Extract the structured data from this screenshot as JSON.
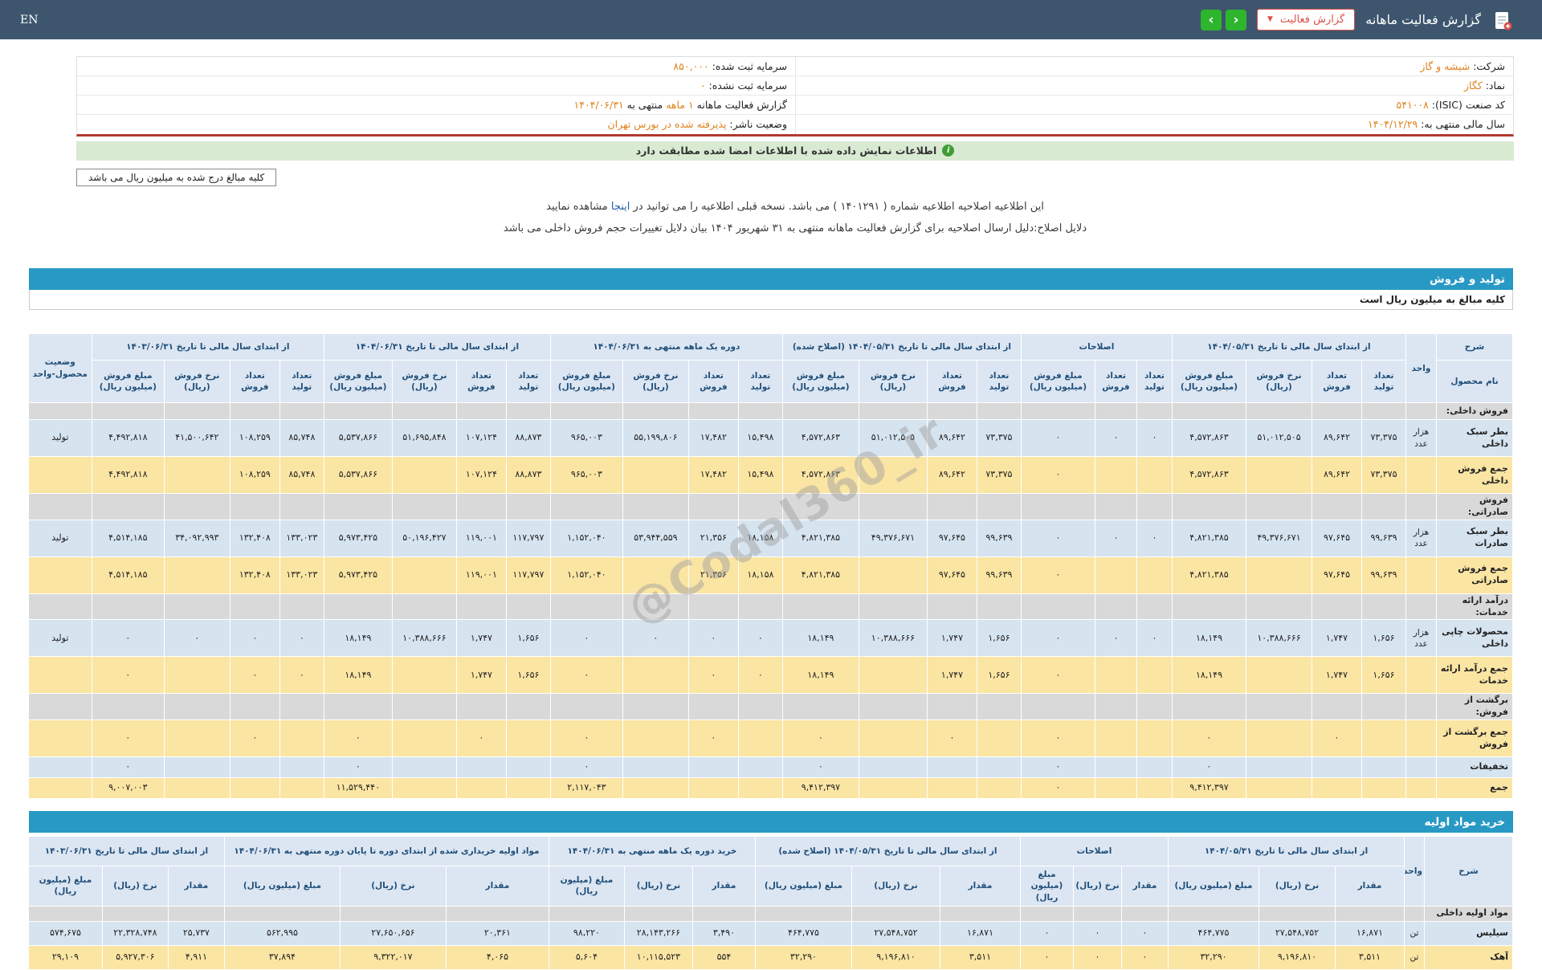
{
  "colors": {
    "topbar": "#3d566e",
    "nav_green": "#2db52d",
    "report_btn_red": "#d9534a",
    "value_orange": "#e0821e",
    "signed_bar_bg": "#d9ead3",
    "signed_icon_green": "#3f9c35",
    "section_bar_blue": "#2899c4",
    "table_header_bg": "#dce6f2",
    "table_header_text": "#1f4e79",
    "row_blue": "#d6e4f0",
    "row_yellow": "#fbe5a3",
    "row_gray": "#d9d9d9",
    "divider_red": "#b03a2e"
  },
  "icons": {
    "chevron_down": "▼",
    "nav_left": "‹",
    "nav_right": "›",
    "info": "i"
  },
  "watermark": "@Codal360_ir",
  "topbar": {
    "title": "گزارش فعالیت ماهانه",
    "report_button": "گزارش فعالیت",
    "lang": "EN"
  },
  "info": {
    "company_label": "شرکت:",
    "company": "شیشه و گاز",
    "symbol_label": "نماد:",
    "symbol": "کگاز",
    "isic_label": "کد صنعت (ISIC):",
    "isic": "۵۴۱۰۰۸",
    "fiscal_year_label": "سال مالی منتهی به:",
    "fiscal_year": "۱۴۰۴/۱۲/۲۹",
    "registered_capital_label": "سرمایه ثبت شده:",
    "registered_capital": "۸۵۰,۰۰۰",
    "unregistered_capital_label": "سرمایه ثبت نشده:",
    "unregistered_capital": "۰",
    "report_period_label": "گزارش فعالیت ماهانه",
    "report_period_value": "۱ ماهه",
    "report_period_mid": "منتهی به",
    "report_period_date": "۱۴۰۴/۰۶/۳۱",
    "publisher_status_label": "وضعیت ناشر:",
    "publisher_status": "پذیرفته شده در بورس تهران"
  },
  "signed_bar": "اطلاعات نمایش داده شده با اطلاعات امضا شده مطابقت دارد",
  "amounts_note": "کلیه مبالغ درج شده به میلیون ریال می باشد",
  "amendment": {
    "line1_pre": "این اطلاعیه اصلاحیه اطلاعیه شماره ( ۱۴۰۱۲۹۱ ) می باشد. نسخه قبلی اطلاعیه را می توانید در",
    "line1_link": "اینجا",
    "line1_post": "مشاهده نمایید",
    "line2": "دلایل اصلاح:دلیل ارسال اصلاحیه برای گزارش فعالیت ماهانه منتهی به ۳۱ شهریور ۱۴۰۴ بیان دلایل تغییرات حجم فروش داخلی می باشد"
  },
  "sections": {
    "production_sales": "تولید و فروش",
    "raw_materials": "خرید مواد اولیه"
  },
  "table_note": "کلیه مبالغ به میلیون ریال است",
  "table1": {
    "headers": {
      "sharh": "شرح",
      "product_name": "نام محصول",
      "unit": "واحد",
      "g1": "از ابتدای سال مالی تا تاریخ ۱۴۰۴/۰۵/۳۱",
      "g2": "اصلاحات",
      "g3": "از ابتدای سال مالی تا تاریخ ۱۴۰۴/۰۵/۳۱ (اصلاح شده)",
      "g4": "دوره یک ماهه منتهی به ۱۴۰۴/۰۶/۳۱",
      "g5": "از ابتدای سال مالی تا تاریخ ۱۴۰۴/۰۶/۳۱",
      "g6": "از ابتدای سال مالی تا تاریخ ۱۴۰۳/۰۶/۳۱",
      "status": "وضعیت محصول-واحد",
      "qty_prod": "تعداد تولید",
      "qty_sale": "تعداد فروش",
      "rate": "نرخ فروش (ریال)",
      "amount": "مبلغ فروش (میلیون ریال)"
    },
    "rows": [
      {
        "type": "section",
        "label": "فروش داخلی:"
      },
      {
        "type": "product",
        "label": "بطر سبک داخلی",
        "unit": "هزار عدد",
        "status": "تولید",
        "cells": [
          "۷۳,۳۷۵",
          "۸۹,۶۴۲",
          "۵۱,۰۱۲,۵۰۵",
          "۴,۵۷۲,۸۶۳",
          "۰",
          "۰",
          "۰",
          "۷۳,۳۷۵",
          "۸۹,۶۴۲",
          "۵۱,۰۱۲,۵۰۵",
          "۴,۵۷۲,۸۶۳",
          "۱۵,۴۹۸",
          "۱۷,۴۸۲",
          "۵۵,۱۹۹,۸۰۶",
          "۹۶۵,۰۰۳",
          "۸۸,۸۷۳",
          "۱۰۷,۱۲۴",
          "۵۱,۶۹۵,۸۴۸",
          "۵,۵۳۷,۸۶۶",
          "۸۵,۷۴۸",
          "۱۰۸,۲۵۹",
          "۴۱,۵۰۰,۶۴۲",
          "۴,۴۹۲,۸۱۸"
        ]
      },
      {
        "type": "subtotal",
        "label": "جمع فروش داخلی",
        "cells": [
          "۷۳,۳۷۵",
          "۸۹,۶۴۲",
          "",
          "۴,۵۷۲,۸۶۳",
          "",
          "",
          "۰",
          "۷۳,۳۷۵",
          "۸۹,۶۴۲",
          "",
          "۴,۵۷۲,۸۶۳",
          "۱۵,۴۹۸",
          "۱۷,۴۸۲",
          "",
          "۹۶۵,۰۰۳",
          "۸۸,۸۷۳",
          "۱۰۷,۱۲۴",
          "",
          "۵,۵۳۷,۸۶۶",
          "۸۵,۷۴۸",
          "۱۰۸,۲۵۹",
          "",
          "۴,۴۹۲,۸۱۸"
        ]
      },
      {
        "type": "section",
        "label": "فروش صادراتی:"
      },
      {
        "type": "product",
        "label": "بطر سبک صادرات",
        "unit": "هزار عدد",
        "status": "تولید",
        "cells": [
          "۹۹,۶۳۹",
          "۹۷,۶۴۵",
          "۴۹,۳۷۶,۶۷۱",
          "۴,۸۲۱,۳۸۵",
          "۰",
          "۰",
          "۰",
          "۹۹,۶۳۹",
          "۹۷,۶۴۵",
          "۴۹,۳۷۶,۶۷۱",
          "۴,۸۲۱,۳۸۵",
          "۱۸,۱۵۸",
          "۲۱,۳۵۶",
          "۵۳,۹۴۴,۵۵۹",
          "۱,۱۵۲,۰۴۰",
          "۱۱۷,۷۹۷",
          "۱۱۹,۰۰۱",
          "۵۰,۱۹۶,۴۲۷",
          "۵,۹۷۳,۴۲۵",
          "۱۳۳,۰۲۳",
          "۱۳۲,۴۰۸",
          "۳۴,۰۹۲,۹۹۳",
          "۴,۵۱۴,۱۸۵"
        ]
      },
      {
        "type": "subtotal",
        "label": "جمع فروش صادراتی",
        "cells": [
          "۹۹,۶۳۹",
          "۹۷,۶۴۵",
          "",
          "۴,۸۲۱,۳۸۵",
          "",
          "",
          "۰",
          "۹۹,۶۳۹",
          "۹۷,۶۴۵",
          "",
          "۴,۸۲۱,۳۸۵",
          "۱۸,۱۵۸",
          "۲۱,۳۵۶",
          "",
          "۱,۱۵۲,۰۴۰",
          "۱۱۷,۷۹۷",
          "۱۱۹,۰۰۱",
          "",
          "۵,۹۷۳,۴۲۵",
          "۱۳۳,۰۲۳",
          "۱۳۲,۴۰۸",
          "",
          "۴,۵۱۴,۱۸۵"
        ]
      },
      {
        "type": "section",
        "label": "درآمد ارائه خدمات:"
      },
      {
        "type": "product",
        "label": "محصولات چاپی داخلی",
        "unit": "هزار عدد",
        "status": "تولید",
        "cells": [
          "۱,۶۵۶",
          "۱,۷۴۷",
          "۱۰,۳۸۸,۶۶۶",
          "۱۸,۱۴۹",
          "۰",
          "۰",
          "۰",
          "۱,۶۵۶",
          "۱,۷۴۷",
          "۱۰,۳۸۸,۶۶۶",
          "۱۸,۱۴۹",
          "۰",
          "۰",
          "۰",
          "۰",
          "۱,۶۵۶",
          "۱,۷۴۷",
          "۱۰,۳۸۸,۶۶۶",
          "۱۸,۱۴۹",
          "۰",
          "۰",
          "۰",
          "۰"
        ]
      },
      {
        "type": "subtotal",
        "label": "جمع درآمد ارائه خدمات",
        "cells": [
          "۱,۶۵۶",
          "۱,۷۴۷",
          "",
          "۱۸,۱۴۹",
          "",
          "",
          "۰",
          "۱,۶۵۶",
          "۱,۷۴۷",
          "",
          "۱۸,۱۴۹",
          "۰",
          "۰",
          "",
          "۰",
          "۱,۶۵۶",
          "۱,۷۴۷",
          "",
          "۱۸,۱۴۹",
          "۰",
          "۰",
          "",
          "۰"
        ]
      },
      {
        "type": "section",
        "label": "برگشت از فروش:"
      },
      {
        "type": "subtotal",
        "label": "جمع برگشت از فروش",
        "cells": [
          "",
          "۰",
          "",
          "۰",
          "",
          "",
          "۰",
          "",
          "۰",
          "",
          "۰",
          "",
          "۰",
          "",
          "۰",
          "",
          "۰",
          "",
          "۰",
          "",
          "۰",
          "",
          "۰"
        ]
      },
      {
        "type": "discount",
        "label": "تخفیفات",
        "cells": [
          "",
          "",
          "",
          "۰",
          "",
          "",
          "۰",
          "",
          "",
          "",
          "۰",
          "",
          "",
          "",
          "۰",
          "",
          "",
          "",
          "۰",
          "",
          "",
          "",
          "۰"
        ]
      },
      {
        "type": "total",
        "label": "جمع",
        "cells": [
          "",
          "",
          "",
          "۹,۴۱۲,۳۹۷",
          "",
          "",
          "۰",
          "",
          "",
          "",
          "۹,۴۱۲,۳۹۷",
          "",
          "",
          "",
          "۲,۱۱۷,۰۴۳",
          "",
          "",
          "",
          "۱۱,۵۲۹,۴۴۰",
          "",
          "",
          "",
          "۹,۰۰۷,۰۰۳"
        ]
      }
    ]
  },
  "table2": {
    "headers": {
      "sharh": "شرح",
      "unit": "واحد",
      "g1": "از ابتدای سال مالی تا تاریخ ۱۴۰۴/۰۵/۳۱",
      "g2": "اصلاحات",
      "g3": "از ابتدای سال مالی تا تاریخ ۱۴۰۴/۰۵/۳۱ (اصلاح شده)",
      "g4": "خرید دوره یک ماهه منتهی به ۱۴۰۴/۰۶/۳۱",
      "g5": "مواد اولیه خریداری شده از ابتدای دوره تا پایان دوره منتهی به ۱۴۰۴/۰۶/۳۱",
      "g6": "از ابتدای سال مالی تا تاریخ ۱۴۰۳/۰۶/۳۱",
      "qty": "مقدار",
      "rate": "نرخ (ریال)",
      "amount": "مبلغ (میلیون ریال)"
    },
    "rows": [
      {
        "type": "section",
        "label": "مواد اولیه داخلی"
      },
      {
        "type": "product",
        "label": "سیلیس",
        "unit": "تن",
        "cells": [
          "۱۶,۸۷۱",
          "۲۷,۵۴۸,۷۵۲",
          "۴۶۴,۷۷۵",
          "۰",
          "۰",
          "۰",
          "۱۶,۸۷۱",
          "۲۷,۵۴۸,۷۵۲",
          "۴۶۴,۷۷۵",
          "۳,۴۹۰",
          "۲۸,۱۴۳,۲۶۶",
          "۹۸,۲۲۰",
          "۲۰,۳۶۱",
          "۲۷,۶۵۰,۶۵۶",
          "۵۶۲,۹۹۵",
          "۲۵,۷۳۷",
          "۲۲,۳۲۸,۷۴۸",
          "۵۷۴,۶۷۵"
        ]
      },
      {
        "type": "product-alt",
        "label": "آهک",
        "unit": "تن",
        "cells": [
          "۳,۵۱۱",
          "۹,۱۹۶,۸۱۰",
          "۳۲,۲۹۰",
          "۰",
          "۰",
          "۰",
          "۳,۵۱۱",
          "۹,۱۹۶,۸۱۰",
          "۳۲,۲۹۰",
          "۵۵۴",
          "۱۰,۱۱۵,۵۲۳",
          "۵,۶۰۴",
          "۴,۰۶۵",
          "۹,۳۲۲,۰۱۷",
          "۳۷,۸۹۴",
          "۴,۹۱۱",
          "۵,۹۲۷,۳۰۶",
          "۲۹,۱۰۹"
        ]
      }
    ]
  }
}
